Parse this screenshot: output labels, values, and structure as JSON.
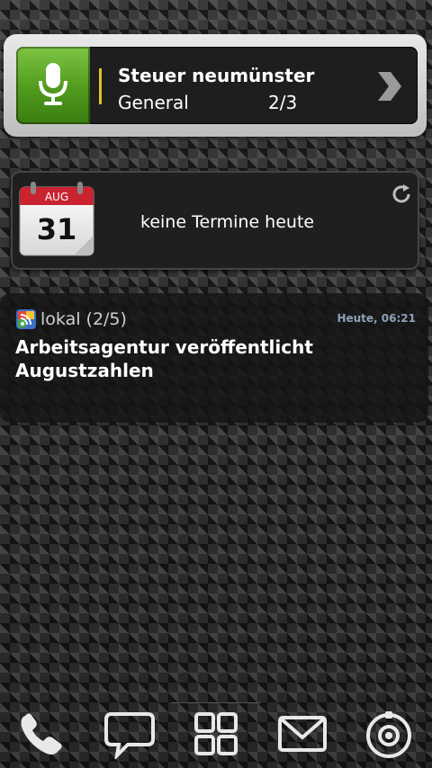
{
  "voice_widget": {
    "title": "Steuer neumünster",
    "category": "General",
    "page": "2/3",
    "accent_color": "#e2c22a",
    "mic_color": "#5fae2a"
  },
  "calendar_widget": {
    "month": "AUG",
    "day": "31",
    "status": "keine Termine heute",
    "refresh_icon": "refresh-icon"
  },
  "news_widget": {
    "source": "lokal (2/5)",
    "time": "Heute, 06:21",
    "headline": "Arbeitsagentur veröffentlicht Augustzahlen"
  },
  "dock": {
    "items": [
      {
        "name": "phone-icon"
      },
      {
        "name": "messages-icon"
      },
      {
        "name": "apps-icon"
      },
      {
        "name": "mail-icon"
      },
      {
        "name": "camera-icon"
      }
    ]
  }
}
